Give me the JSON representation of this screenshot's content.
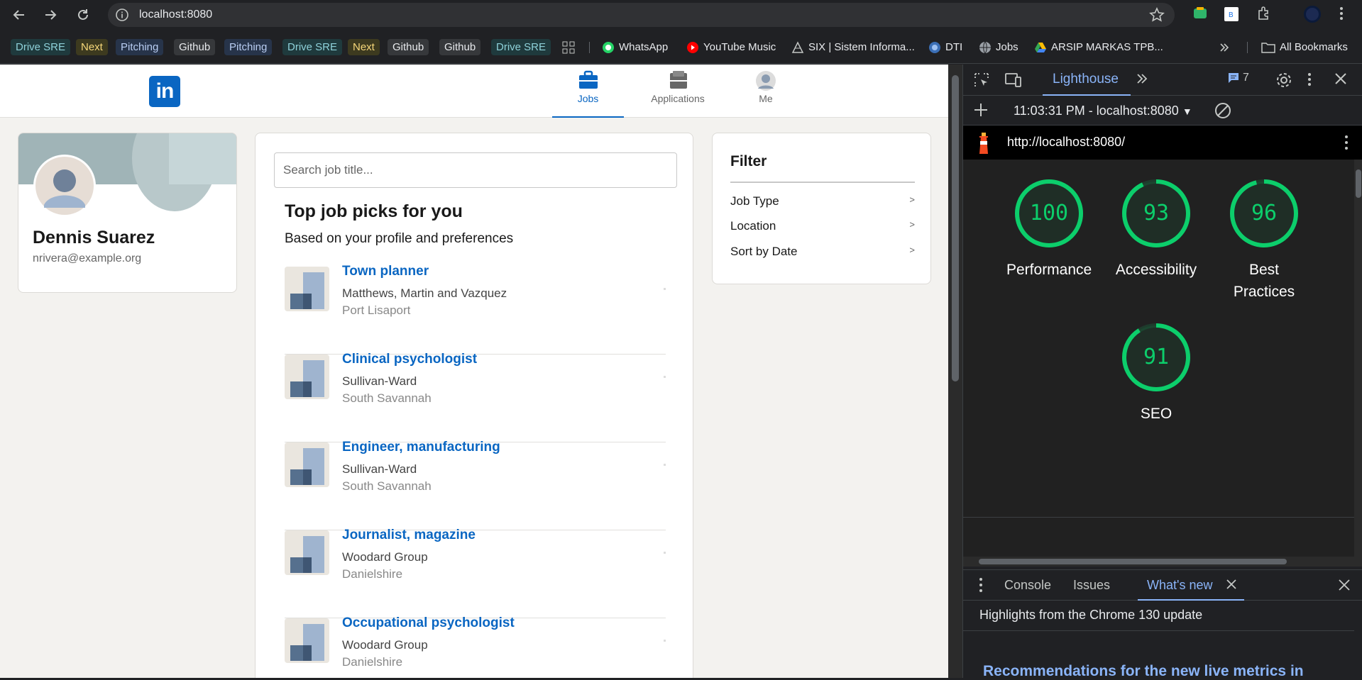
{
  "browser": {
    "url": "localhost:8080",
    "bookmarks": [
      {
        "label": "Drive SRE",
        "style": "teal"
      },
      {
        "label": "Next",
        "style": "yellow"
      },
      {
        "label": "Pitching",
        "style": "blue"
      },
      {
        "label": "Github",
        "style": "gray"
      },
      {
        "label": "Pitching",
        "style": "blue"
      },
      {
        "label": "Drive SRE",
        "style": "teal"
      },
      {
        "label": "Next",
        "style": "yellow"
      },
      {
        "label": "Github",
        "style": "gray"
      },
      {
        "label": "Github",
        "style": "gray"
      },
      {
        "label": "Drive SRE",
        "style": "teal"
      }
    ],
    "bookmark_links": {
      "whatsapp": "WhatsApp",
      "youtube_music": "YouTube Music",
      "six": "SIX | Sistem Informa...",
      "dti": "DTI",
      "jobs": "Jobs",
      "arsip": "ARSIP MARKAS TPB...",
      "all_bookmarks": "All Bookmarks"
    }
  },
  "site": {
    "nav": {
      "jobs": "Jobs",
      "applications": "Applications",
      "me": "Me"
    },
    "profile": {
      "name": "Dennis Suarez",
      "email": "nrivera@example.org"
    },
    "search": {
      "placeholder": "Search job title..."
    },
    "jobs_heading": "Top job picks for you",
    "jobs_subheading": "Based on your profile and preferences",
    "jobs": [
      {
        "title": "Town planner",
        "company": "Matthews, Martin and Vazquez",
        "location": "Port Lisaport"
      },
      {
        "title": "Clinical psychologist",
        "company": "Sullivan-Ward",
        "location": "South Savannah"
      },
      {
        "title": "Engineer, manufacturing",
        "company": "Sullivan-Ward",
        "location": "South Savannah"
      },
      {
        "title": "Journalist, magazine",
        "company": "Woodard Group",
        "location": "Danielshire"
      },
      {
        "title": "Occupational psychologist",
        "company": "Woodard Group",
        "location": "Danielshire"
      }
    ],
    "filter": {
      "title": "Filter",
      "options": [
        "Job Type",
        "Location",
        "Sort by Date"
      ],
      "chevron": ">"
    }
  },
  "devtools": {
    "panel_tab": "Lighthouse",
    "issues_count": "7",
    "report_selector": "11:03:31 PM - localhost:8080",
    "report_url": "http://localhost:8080/",
    "scores": [
      {
        "value": 100,
        "label": "Performance"
      },
      {
        "value": 93,
        "label": "Accessibility"
      },
      {
        "value": 96,
        "label": "Best Practices"
      },
      {
        "value": 91,
        "label": "SEO"
      }
    ],
    "score_color": "#0cce6b",
    "drawer_tabs": {
      "console": "Console",
      "issues": "Issues",
      "whats_new": "What's new"
    },
    "drawer_highlight": "Highlights from the Chrome 130 update",
    "drawer_recommendation": "Recommendations for the new live metrics in"
  }
}
